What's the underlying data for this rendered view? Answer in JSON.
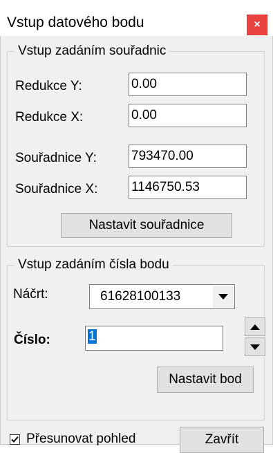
{
  "window": {
    "title": "Vstup datového bodu",
    "close_label": "×"
  },
  "coords_group": {
    "legend": "Vstup zadáním souřadnic",
    "reduction_y": {
      "label": "Redukce Y:",
      "value": "0.00"
    },
    "reduction_x": {
      "label": "Redukce X:",
      "value": "0.00"
    },
    "coord_y": {
      "label": "Souřadnice Y:",
      "value": "793470.00"
    },
    "coord_x": {
      "label": "Souřadnice X:",
      "value": "1146750.53"
    },
    "set_button": "Nastavit souřadnice"
  },
  "point_group": {
    "legend": "Vstup zadáním čísla bodu",
    "sketch_label": "Náčrt:",
    "sketch_value": "61628100133",
    "number_label": "Číslo:",
    "number_value": "1",
    "set_button": "Nastavit bod"
  },
  "footer": {
    "move_view_label": "Přesunovat pohled",
    "move_view_checked": true,
    "close_button": "Zavřít"
  }
}
